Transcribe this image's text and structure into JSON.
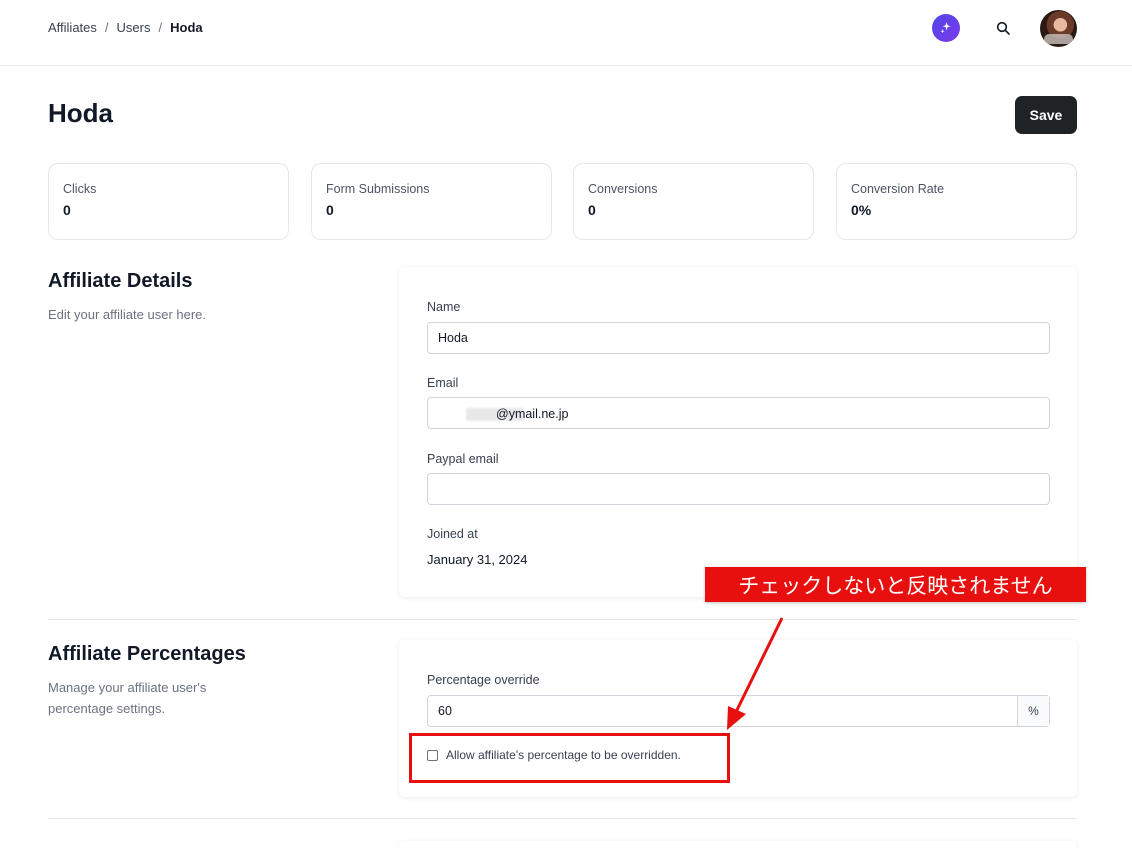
{
  "breadcrumb": {
    "items": [
      "Affiliates",
      "Users"
    ],
    "current": "Hoda",
    "separator": "/"
  },
  "header": {
    "icons": [
      "ai-sparkle-icon",
      "search-icon",
      "avatar"
    ]
  },
  "page": {
    "title": "Hoda",
    "save_label": "Save"
  },
  "stats": [
    {
      "label": "Clicks",
      "value": "0"
    },
    {
      "label": "Form Submissions",
      "value": "0"
    },
    {
      "label": "Conversions",
      "value": "0"
    },
    {
      "label": "Conversion Rate",
      "value": "0%"
    }
  ],
  "details": {
    "title": "Affiliate Details",
    "description": "Edit your affiliate user here.",
    "name_label": "Name",
    "name_value": "Hoda",
    "email_label": "Email",
    "email_value": "@ymail.ne.jp",
    "paypal_label": "Paypal email",
    "paypal_value": "",
    "joined_label": "Joined at",
    "joined_value": "January 31, 2024"
  },
  "percentages": {
    "title": "Affiliate Percentages",
    "description": "Manage your affiliate user's percentage settings.",
    "override_label": "Percentage override",
    "override_value": "60",
    "suffix": "%",
    "checkbox_label": "Allow affiliate's percentage to be overridden.",
    "checkbox_checked": false
  },
  "annotation": {
    "callout_text": "チェックしないと反映されません",
    "color": "#e8100e"
  },
  "colors": {
    "primary_button": "#1f2326",
    "accent": "#4f46e5"
  }
}
